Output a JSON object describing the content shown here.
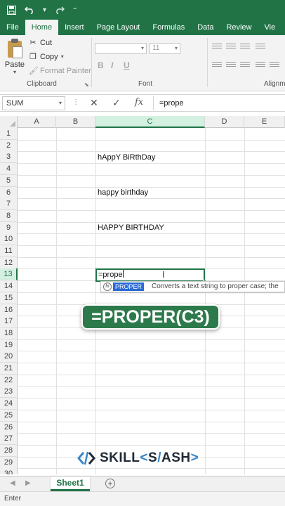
{
  "titlebar": {
    "save_icon": "save-icon",
    "undo_icon": "undo-icon",
    "redo_icon": "redo-icon",
    "customize_icon": "customize-icon"
  },
  "tabs": [
    "File",
    "Home",
    "Insert",
    "Page Layout",
    "Formulas",
    "Data",
    "Review",
    "Vie"
  ],
  "active_tab": "Home",
  "ribbon": {
    "paste_label": "Paste",
    "cut_label": "Cut",
    "copy_label": "Copy",
    "format_painter_label": "Format Painter",
    "clipboard_group": "Clipboard",
    "font_size": "11",
    "font_group": "Font",
    "alignment_group": "Alignm",
    "bold": "B",
    "italic": "I",
    "underline": "U"
  },
  "formula_bar": {
    "name_box": "SUM",
    "cancel_glyph": "✕",
    "enter_glyph": "✓",
    "fx_glyph": "fx",
    "content": "=prope"
  },
  "columns": [
    "A",
    "B",
    "C",
    "D",
    "E"
  ],
  "rows": [
    "1",
    "2",
    "3",
    "4",
    "5",
    "6",
    "7",
    "8",
    "9",
    "10",
    "11",
    "12",
    "13",
    "14",
    "15",
    "16",
    "17",
    "18",
    "19",
    "20",
    "21",
    "22",
    "23",
    "24",
    "25",
    "26",
    "27",
    "28",
    "29",
    "30"
  ],
  "cells": {
    "C3": "hAppY BiRthDay",
    "C6": "happy birthday",
    "C9": "HAPPY BIRTHDAY",
    "C13": "=prope"
  },
  "autocomplete": {
    "function_name": "PROPER",
    "description": "Converts a text string to proper case; the"
  },
  "overlay_formula": "=PROPER(C3)",
  "brand": {
    "part1": "SKILL",
    "part2": "<",
    "part3": "S",
    "part4": "/",
    "part5": "ASH",
    "part6": ">"
  },
  "sheet_tab": "Sheet1",
  "status": "Enter",
  "colors": {
    "excel_green": "#217346",
    "pill_green": "#2c7a4b",
    "brand_blue": "#3a86c8",
    "brand_dark": "#1f2a36"
  }
}
